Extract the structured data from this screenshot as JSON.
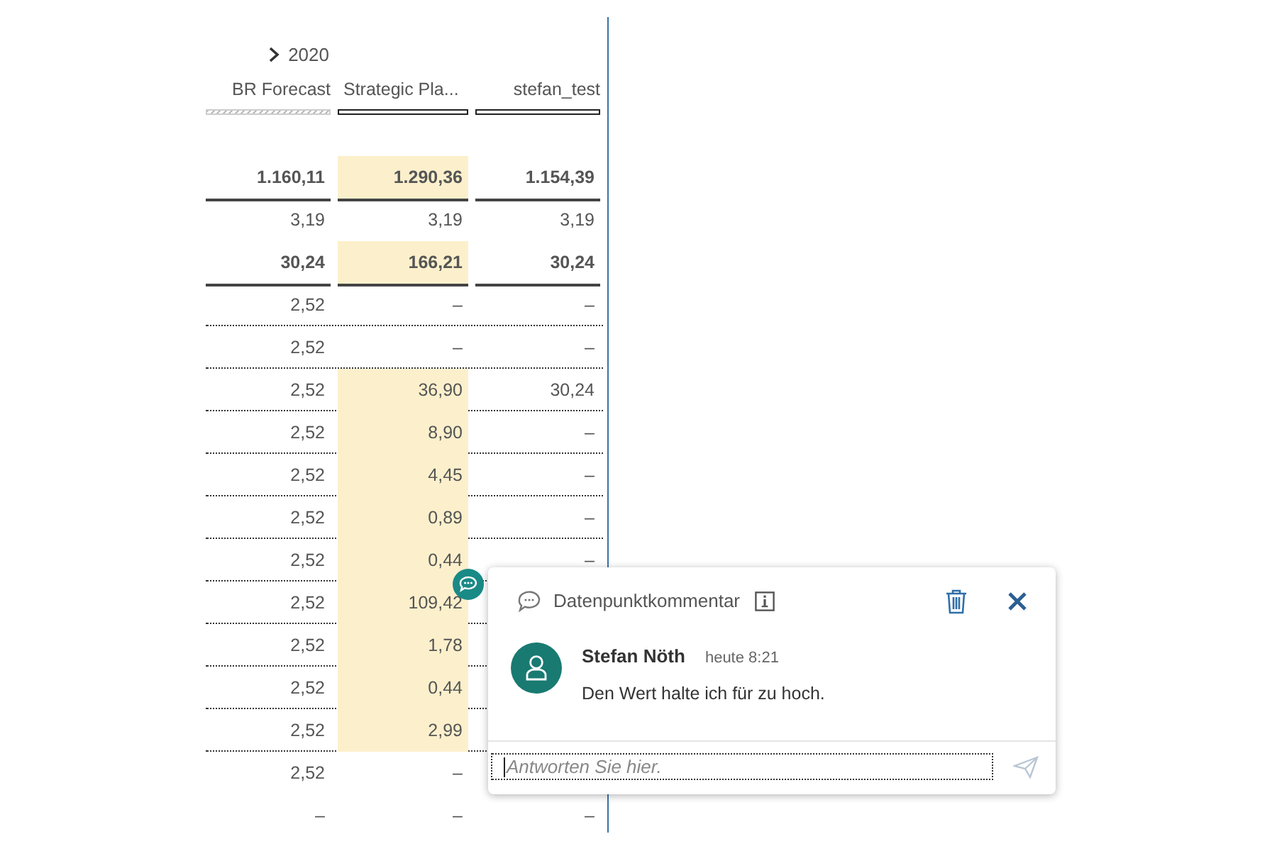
{
  "year_header": {
    "label": "2020",
    "expanded": false
  },
  "columns": [
    {
      "label": "BR Forecast",
      "kind": "hatched"
    },
    {
      "label": "Strategic Pla...",
      "kind": "outlined"
    },
    {
      "label": "stefan_test",
      "kind": "outlined"
    }
  ],
  "rows": [
    {
      "kind": "total",
      "cells": [
        {
          "text": "1.160,11",
          "changed": false
        },
        {
          "text": "1.290,36",
          "changed": true
        },
        {
          "text": "1.154,39",
          "changed": false
        }
      ]
    },
    {
      "kind": "plain",
      "cells": [
        {
          "text": "3,19",
          "changed": false
        },
        {
          "text": "3,19",
          "changed": false
        },
        {
          "text": "3,19",
          "changed": false
        }
      ]
    },
    {
      "kind": "total",
      "cells": [
        {
          "text": "30,24",
          "changed": false
        },
        {
          "text": "166,21",
          "changed": true
        },
        {
          "text": "30,24",
          "changed": false
        }
      ]
    },
    {
      "kind": "detail",
      "cells": [
        {
          "text": "2,52",
          "changed": false
        },
        {
          "text": "–",
          "changed": false
        },
        {
          "text": "–",
          "changed": false
        }
      ]
    },
    {
      "kind": "detail",
      "cells": [
        {
          "text": "2,52",
          "changed": false
        },
        {
          "text": "–",
          "changed": false
        },
        {
          "text": "–",
          "changed": false
        }
      ]
    },
    {
      "kind": "detail",
      "cells": [
        {
          "text": "2,52",
          "changed": false
        },
        {
          "text": "36,90",
          "changed": true
        },
        {
          "text": "30,24",
          "changed": false
        }
      ]
    },
    {
      "kind": "detail",
      "cells": [
        {
          "text": "2,52",
          "changed": false
        },
        {
          "text": "8,90",
          "changed": true
        },
        {
          "text": "–",
          "changed": false
        }
      ]
    },
    {
      "kind": "detail",
      "cells": [
        {
          "text": "2,52",
          "changed": false
        },
        {
          "text": "4,45",
          "changed": true
        },
        {
          "text": "–",
          "changed": false
        }
      ]
    },
    {
      "kind": "detail",
      "cells": [
        {
          "text": "2,52",
          "changed": false
        },
        {
          "text": "0,89",
          "changed": true
        },
        {
          "text": "–",
          "changed": false
        }
      ]
    },
    {
      "kind": "detail",
      "cells": [
        {
          "text": "2,52",
          "changed": false
        },
        {
          "text": "0,44",
          "changed": true
        },
        {
          "text": "–",
          "changed": false
        }
      ]
    },
    {
      "kind": "detail",
      "cells": [
        {
          "text": "2,52",
          "changed": false
        },
        {
          "text": "109,42",
          "changed": true
        }
      ]
    },
    {
      "kind": "detail",
      "cells": [
        {
          "text": "2,52",
          "changed": false
        },
        {
          "text": "1,78",
          "changed": true
        }
      ]
    },
    {
      "kind": "detail",
      "cells": [
        {
          "text": "2,52",
          "changed": false
        },
        {
          "text": "0,44",
          "changed": true
        }
      ]
    },
    {
      "kind": "detail",
      "cells": [
        {
          "text": "2,52",
          "changed": false
        },
        {
          "text": "2,99",
          "changed": true
        }
      ]
    },
    {
      "kind": "plain",
      "cells": [
        {
          "text": "2,52",
          "changed": false
        },
        {
          "text": "–",
          "changed": false
        }
      ]
    },
    {
      "kind": "plain",
      "cells": [
        {
          "text": "–",
          "changed": false
        },
        {
          "text": "–",
          "changed": false
        },
        {
          "text": "–",
          "changed": false
        }
      ]
    }
  ],
  "comment_popup": {
    "title": "Datenpunktkommentar",
    "author": "Stefan Nöth",
    "time": "heute 8:21",
    "text": "Den Wert halte ich für zu hoch.",
    "reply": {
      "placeholder": "Antworten Sie hier."
    }
  }
}
